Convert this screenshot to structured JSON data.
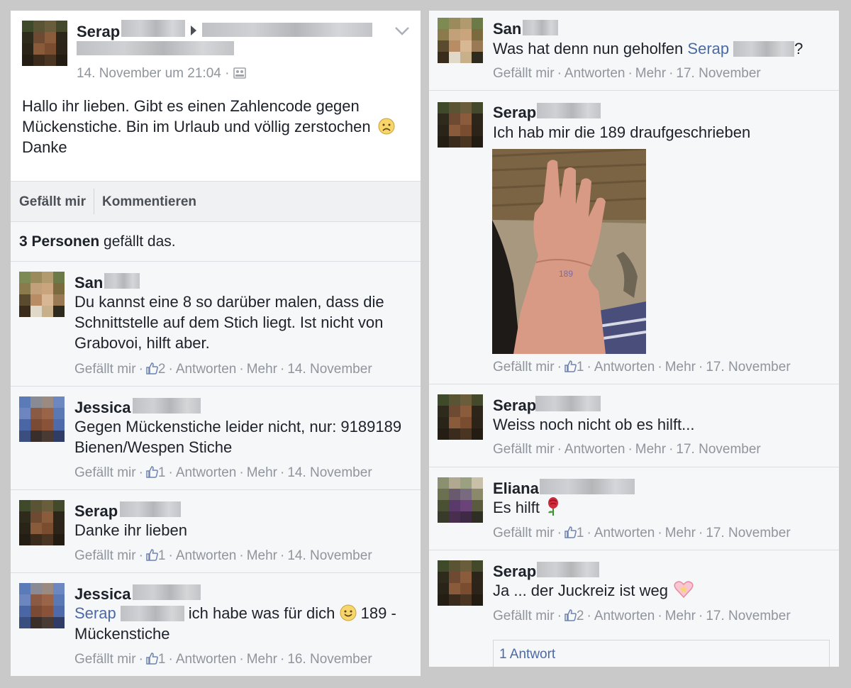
{
  "post": {
    "author": "Serap",
    "timestamp": "14. November um 21:04 ·",
    "body_line1": "Hallo ihr lieben. Gibt es einen Zahlencode gegen",
    "body_line2": "Mückenstiche. Bin im Urlaub und völlig zerstochen",
    "body_line3": "Danke",
    "like_action": "Gefällt mir",
    "comment_action": "Kommentieren",
    "likes_count_bold": "3 Personen",
    "likes_suffix": " gefällt das."
  },
  "labels": {
    "like": "Gefällt mir",
    "reply": "Antworten",
    "more": "Mehr",
    "dot": "·"
  },
  "comments_left": [
    {
      "author": "San",
      "lines": [
        "Du kannst eine 8 so darüber malen, dass die",
        "Schnittstelle auf dem Stich liegt. Ist nicht von",
        "Grabovoi, hilft aber."
      ],
      "likes": "2",
      "date": "14. November"
    },
    {
      "author": "Jessica",
      "lines": [
        "Gegen Mückenstiche leider nicht, nur: 9189189",
        "Bienen/Wespen Stiche"
      ],
      "likes": "1",
      "date": "14. November"
    },
    {
      "author": "Serap",
      "lines": [
        "Danke ihr lieben"
      ],
      "likes": "1",
      "date": "14. November"
    },
    {
      "author": "Jessica",
      "mention": "Serap",
      "line1_rest": "ich habe was für dich",
      "line1_tail": "189 -",
      "line2": "Mückenstiche",
      "likes": "1",
      "date": "16. November"
    }
  ],
  "comments_right": [
    {
      "author": "San",
      "line_prefix": "Was hat denn nun geholfen",
      "mention": "Serap",
      "line_suffix": "?",
      "date": "17. November"
    },
    {
      "author": "Serap",
      "lines": [
        "Ich hab mir die 189 draufgeschrieben"
      ],
      "photo_text": "189",
      "likes": "1",
      "date": "17. November"
    },
    {
      "author": "Serap",
      "lines": [
        "Weiss noch nicht ob es hilft..."
      ],
      "date": "17. November"
    },
    {
      "author": "Eliana",
      "lines": [
        "Es hilft"
      ],
      "likes": "1",
      "date": "17. November"
    },
    {
      "author": "Serap",
      "lines": [
        "Ja ... der Juckreiz ist weg"
      ],
      "likes": "2",
      "date": "17. November",
      "replies": "1 Antwort"
    }
  ],
  "icons": [
    "chevron-down-icon",
    "audience-icon",
    "thumbs-up-icon",
    "sad-face-emoji",
    "smile-emoji",
    "rose-emoji",
    "sparkling-heart-emoji"
  ],
  "colors": {
    "link": "#4b6aa5",
    "meta": "#90949c",
    "background": "#c9c9c9",
    "card": "#f6f7f9"
  }
}
